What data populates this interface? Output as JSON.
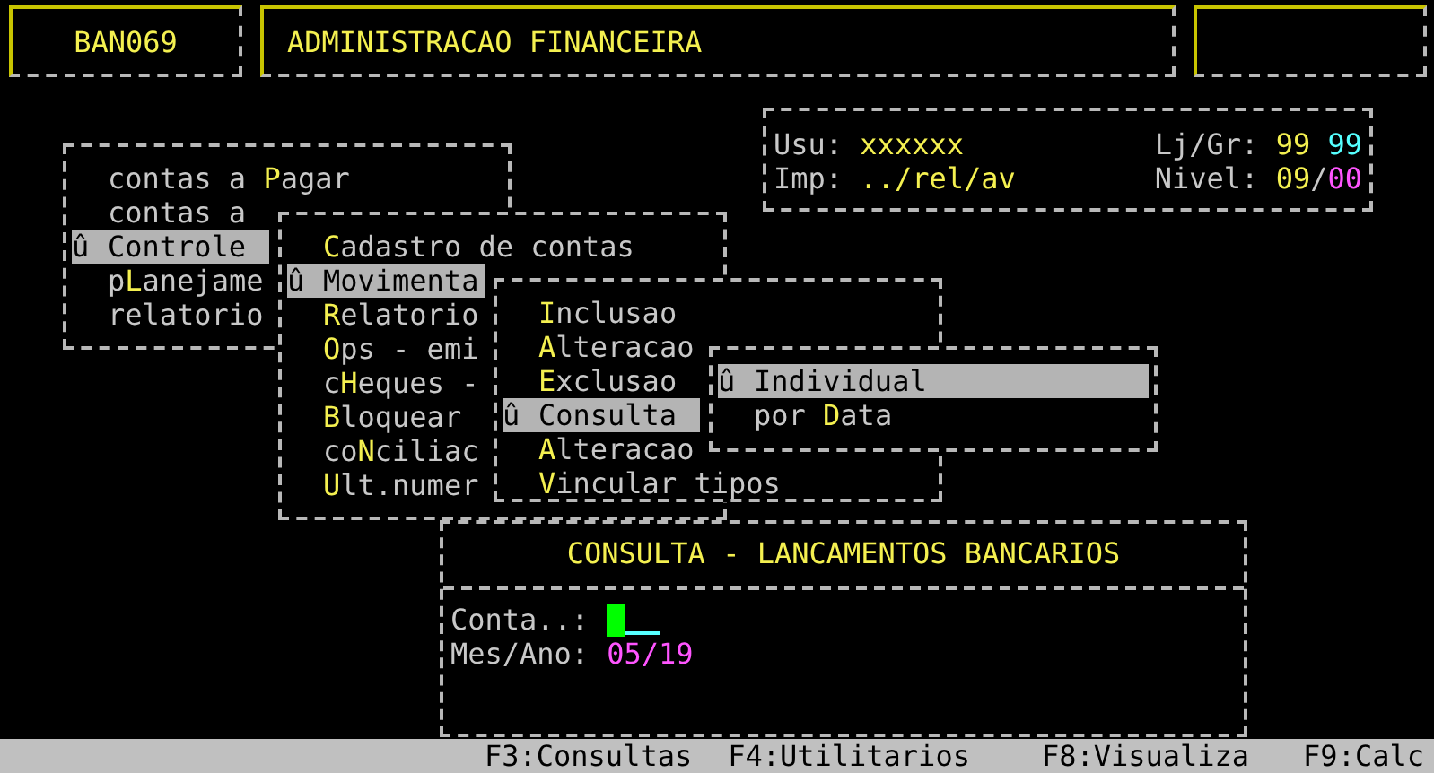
{
  "header": {
    "code": "BAN069",
    "title": "ADMINISTRACAO FINANCEIRA"
  },
  "session": {
    "user_label": "Usu:",
    "user": "xxxxxx",
    "printer_label": "Imp:",
    "printer": "../rel/av",
    "store_group_label": "Lj/Gr:",
    "store": "99",
    "group": "99",
    "level_label": "Nivel:",
    "level_major": "09",
    "level_separator": "/",
    "level_minor": "00"
  },
  "menus": [
    {
      "items": [
        {
          "label": "contas a **P**agar",
          "selected": false
        },
        {
          "label": "contas a",
          "selected": false
        },
        {
          "marker": "û",
          "label": "Controle",
          "selected": true
        },
        {
          "label": "p**L**anejame",
          "selected": false
        },
        {
          "label": "relatorio",
          "selected": false
        }
      ]
    },
    {
      "items": [
        {
          "label": "**C**adastro de contas",
          "selected": false
        },
        {
          "marker": "û",
          "label": "Movimenta",
          "selected": true
        },
        {
          "label": "**R**elatorio",
          "selected": false
        },
        {
          "label": "**O**ps - emi",
          "selected": false
        },
        {
          "label": "c**H**eques -",
          "selected": false
        },
        {
          "label": "**B**loquear",
          "selected": false
        },
        {
          "label": "co**N**ciliac",
          "selected": false
        },
        {
          "label": "**U**lt.numer",
          "selected": false
        }
      ]
    },
    {
      "items": [
        {
          "label": "**I**nclusao",
          "selected": false
        },
        {
          "label": "**A**lteracao",
          "selected": false
        },
        {
          "label": "**E**xclusao",
          "selected": false
        },
        {
          "marker": "û",
          "label": "Consulta",
          "selected": true
        },
        {
          "label": "**A**lteracao",
          "selected": false
        },
        {
          "label": "**V**incular tipos",
          "selected": false
        }
      ]
    },
    {
      "items": [
        {
          "marker": "û",
          "label": "Individual",
          "selected": true
        },
        {
          "label": "por **D**ata",
          "selected": false
        }
      ]
    }
  ],
  "dialog": {
    "title": "CONSULTA - LANCAMENTOS BANCARIOS",
    "fields": [
      {
        "label": "Conta..:",
        "focused": true
      },
      {
        "label": "Mes/Ano:",
        "value": "05/19",
        "focused": false
      }
    ]
  },
  "status_bar": [
    "F3:Consultas",
    "F4:Utilitarios",
    "F8:Visualiza",
    "F9:Calc"
  ]
}
